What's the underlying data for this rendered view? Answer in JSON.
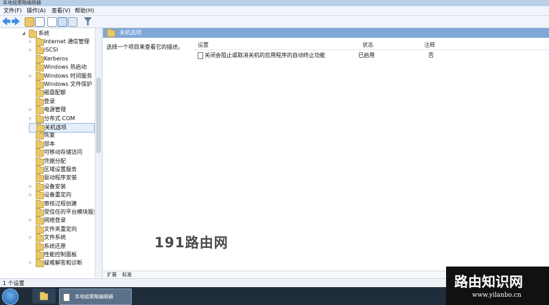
{
  "window": {
    "title": "本地组策略编辑器"
  },
  "menu": [
    "文件(F)",
    "操作(A)",
    "查看(V)",
    "帮助(H)"
  ],
  "tree": {
    "root": "系统",
    "items": [
      {
        "label": "Internet 通信管理",
        "expandable": true
      },
      {
        "label": "iSCSI",
        "expandable": true
      },
      {
        "label": "Kerberos",
        "expandable": false
      },
      {
        "label": "Windows 热启动",
        "expandable": false
      },
      {
        "label": "Windows 时间服务",
        "expandable": true
      },
      {
        "label": "Windows 文件保护",
        "expandable": false
      },
      {
        "label": "磁盘配额",
        "expandable": false
      },
      {
        "label": "登录",
        "expandable": false
      },
      {
        "label": "电源管理",
        "expandable": true
      },
      {
        "label": "分布式 COM",
        "expandable": true
      },
      {
        "label": "关机选项",
        "expandable": false,
        "selected": true
      },
      {
        "label": "恢复",
        "expandable": false
      },
      {
        "label": "部本",
        "expandable": false
      },
      {
        "label": "可移动存储访问",
        "expandable": false
      },
      {
        "label": "凭据分配",
        "expandable": false
      },
      {
        "label": "区域设置服务",
        "expandable": false
      },
      {
        "label": "驱动程序安装",
        "expandable": false
      },
      {
        "label": "设备安装",
        "expandable": true
      },
      {
        "label": "设备重定向",
        "expandable": true
      },
      {
        "label": "审核过程创建",
        "expandable": false
      },
      {
        "label": "受信任的平台模块服务",
        "expandable": false
      },
      {
        "label": "网络登录",
        "expandable": true
      },
      {
        "label": "文件夹重定向",
        "expandable": false
      },
      {
        "label": "文件系统",
        "expandable": true
      },
      {
        "label": "系统还原",
        "expandable": false
      },
      {
        "label": "性能控制面板",
        "expandable": false
      },
      {
        "label": "疑难解答和诊断",
        "expandable": true
      }
    ]
  },
  "pane": {
    "title": "关机选项",
    "description": "选择一个项目来查看它的描述。",
    "columns": {
      "setting": "设置",
      "state": "状态",
      "comment": "注释"
    },
    "rows": [
      {
        "setting": "关闭会阻止或取消关机的应用程序的自动终止功能",
        "state": "已启用",
        "comment": "否"
      }
    ],
    "tabs": [
      "扩展",
      "标准"
    ]
  },
  "status": "1 个设置",
  "taskbar": {
    "active_window": "本地组策略编辑器"
  },
  "watermark": {
    "center": "191路由网",
    "brand_title": "路由知识网",
    "brand_url": "www.yilanbo.cn"
  },
  "colors": {
    "pane_header": "#7fa7d7",
    "folder": "#e8c86a",
    "taskbar": "#1f2c3a"
  }
}
